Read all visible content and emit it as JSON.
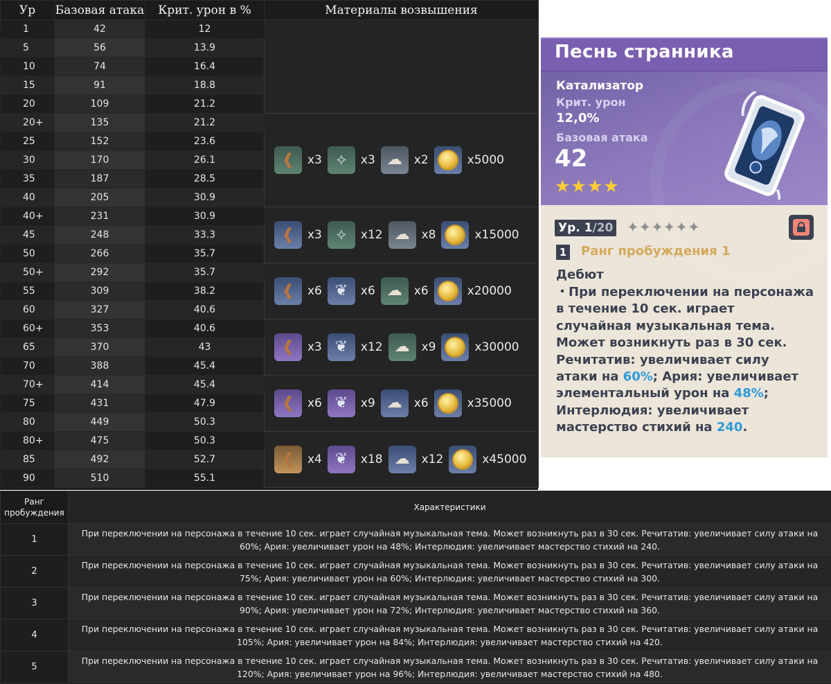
{
  "stats_table": {
    "headers": {
      "level": "Ур",
      "base_atk": "Базовая атака",
      "crit_dmg": "Крит. урон в %",
      "materials": "Материалы возвышения"
    },
    "rows": [
      {
        "level": "1",
        "atk": "42",
        "crit": "12"
      },
      {
        "level": "5",
        "atk": "56",
        "crit": "13.9"
      },
      {
        "level": "10",
        "atk": "74",
        "crit": "16.4"
      },
      {
        "level": "15",
        "atk": "91",
        "crit": "18.8"
      },
      {
        "level": "20",
        "atk": "109",
        "crit": "21.2"
      },
      {
        "level": "20+",
        "atk": "135",
        "crit": "21.2"
      },
      {
        "level": "25",
        "atk": "152",
        "crit": "23.6"
      },
      {
        "level": "30",
        "atk": "170",
        "crit": "26.1"
      },
      {
        "level": "35",
        "atk": "187",
        "crit": "28.5"
      },
      {
        "level": "40",
        "atk": "205",
        "crit": "30.9"
      },
      {
        "level": "40+",
        "atk": "231",
        "crit": "30.9"
      },
      {
        "level": "45",
        "atk": "248",
        "crit": "33.3"
      },
      {
        "level": "50",
        "atk": "266",
        "crit": "35.7"
      },
      {
        "level": "50+",
        "atk": "292",
        "crit": "35.7"
      },
      {
        "level": "55",
        "atk": "309",
        "crit": "38.2"
      },
      {
        "level": "60",
        "atk": "327",
        "crit": "40.6"
      },
      {
        "level": "60+",
        "atk": "353",
        "crit": "40.6"
      },
      {
        "level": "65",
        "atk": "370",
        "crit": "43"
      },
      {
        "level": "70",
        "atk": "388",
        "crit": "45.4"
      },
      {
        "level": "70+",
        "atk": "414",
        "crit": "45.4"
      },
      {
        "level": "75",
        "atk": "431",
        "crit": "47.9"
      },
      {
        "level": "80",
        "atk": "449",
        "crit": "50.3"
      },
      {
        "level": "80+",
        "atk": "475",
        "crit": "50.3"
      },
      {
        "level": "85",
        "atk": "492",
        "crit": "52.7"
      },
      {
        "level": "90",
        "atk": "510",
        "crit": "55.1"
      }
    ],
    "materials": [
      {
        "items": [
          {
            "icon": "fang-icon",
            "qty": "x3"
          },
          {
            "icon": "branch-icon",
            "qty": "x3"
          },
          {
            "icon": "cloud-icon",
            "qty": "x2"
          },
          {
            "icon": "mora-coin-icon",
            "qty": "x5000"
          }
        ]
      },
      {
        "items": [
          {
            "icon": "fang-icon",
            "qty": "x3"
          },
          {
            "icon": "branch-icon",
            "qty": "x12"
          },
          {
            "icon": "cloud-icon",
            "qty": "x8"
          },
          {
            "icon": "mora-coin-icon",
            "qty": "x15000"
          }
        ]
      },
      {
        "items": [
          {
            "icon": "fang-icon",
            "qty": "x6"
          },
          {
            "icon": "bird-icon",
            "qty": "x6"
          },
          {
            "icon": "cloud-icon",
            "qty": "x6"
          },
          {
            "icon": "mora-coin-icon",
            "qty": "x20000"
          }
        ]
      },
      {
        "items": [
          {
            "icon": "fang-icon",
            "qty": "x3"
          },
          {
            "icon": "bird-icon",
            "qty": "x12"
          },
          {
            "icon": "cloud-icon",
            "qty": "x9"
          },
          {
            "icon": "mora-coin-icon",
            "qty": "x30000"
          }
        ]
      },
      {
        "items": [
          {
            "icon": "fang-icon",
            "qty": "x6"
          },
          {
            "icon": "bird-icon",
            "qty": "x9"
          },
          {
            "icon": "cloud-icon",
            "qty": "x6"
          },
          {
            "icon": "mora-coin-icon",
            "qty": "x35000"
          }
        ]
      },
      {
        "items": [
          {
            "icon": "fang-icon",
            "qty": "x4"
          },
          {
            "icon": "bird-icon",
            "qty": "x18"
          },
          {
            "icon": "cloud-icon",
            "qty": "x12"
          },
          {
            "icon": "mora-coin-icon",
            "qty": "x45000"
          }
        ]
      }
    ]
  },
  "weapon_card": {
    "title": "Песнь странника",
    "type": "Катализатор",
    "substat_label": "Крит. урон",
    "substat_value": "12,0%",
    "base_atk_label": "Базовая атака",
    "base_atk_value": "42",
    "rarity_stars": "★★★★",
    "level_prefix": "Ур. ",
    "level_current": "1",
    "level_max": "/20",
    "refine_stars": "✦✦✦✦✦✦",
    "refinement_number": "1",
    "refinement_label": "Ранг пробуждения 1",
    "passive_name": "Дебют",
    "passive_text_parts": [
      "・При переключении на персонажа в течение 10 сек. играет случайная музыкальная тема. Может возникнуть раз в 30 сек. Речитатив: увеличивает силу атаки на ",
      "60%",
      "; Ария: увеличивает элементальный урон на ",
      "48%",
      "; Интерлюдия: увеличивает мастерство стихий на ",
      "240",
      "."
    ],
    "colors": {
      "header": "#7a5fb0",
      "highlight": "#2f9bd6",
      "refine_label": "#d4a95b",
      "star": "#ffcc32"
    }
  },
  "refinement_table": {
    "headers": {
      "rank": "Ранг пробуждения",
      "desc": "Характеристики"
    },
    "rows": [
      {
        "rank": "1",
        "desc": "При переключении на персонажа в течение 10 сек. играет случайная музыкальная тема. Может возникнуть раз в 30 сек. Речитатив: увеличивает силу атаки на 60%; Ария: увеличивает урон на 48%; Интерлюдия: увеличивает мастерство стихий на 240."
      },
      {
        "rank": "2",
        "desc": "При переключении на персонажа в течение 10 сек. играет случайная музыкальная тема. Может возникнуть раз в 30 сек. Речитатив: увеличивает силу атаки на 75%; Ария: увеличивает урон на 60%; Интерлюдия: увеличивает мастерство стихий на 300."
      },
      {
        "rank": "3",
        "desc": "При переключении на персонажа в течение 10 сек. играет случайная музыкальная тема. Может возникнуть раз в 30 сек. Речитатив: увеличивает силу атаки на 90%; Ария: увеличивает урон на 72%; Интерлюдия: увеличивает мастерство стихий на 360."
      },
      {
        "rank": "4",
        "desc": "При переключении на персонажа в течение 10 сек. играет случайная музыкальная тема. Может возникнуть раз в 30 сек. Речитатив: увеличивает силу атаки на 105%; Ария: увеличивает урон на 84%; Интерлюдия: увеличивает мастерство стихий на 420."
      },
      {
        "rank": "5",
        "desc": "При переключении на персонажа в течение 10 сек. играет случайная музыкальная тема. Может возникнуть раз в 30 сек. Речитатив: увеличивает силу атаки на 120%; Ария: увеличивает урон на 96%; Интерлюдия: увеличивает мастерство стихий на 480."
      }
    ]
  }
}
